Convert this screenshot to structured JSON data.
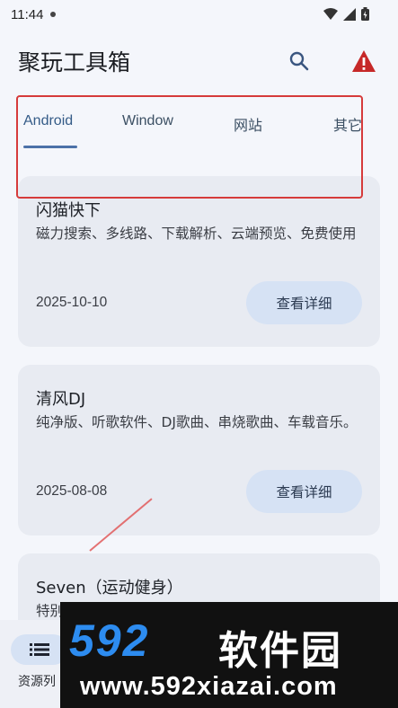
{
  "status_bar": {
    "time": "11:44"
  },
  "app_bar": {
    "title": "聚玩工具箱",
    "icons": [
      "search-icon",
      "warning-icon"
    ],
    "warning_color": "#c62828"
  },
  "tabs": [
    {
      "label": "Android",
      "active": true
    },
    {
      "label": "Window",
      "active": false
    },
    {
      "label": "网站",
      "active": false
    },
    {
      "label": "其它",
      "active": false
    }
  ],
  "cards": [
    {
      "title": "闪猫快下",
      "desc": "磁力搜索、多线路、下载解析、云端预览、免费使用",
      "date": "2025-10-10",
      "button": "查看详细"
    },
    {
      "title": "清风DJ",
      "desc": "纯净版、听歌软件、DJ歌曲、串烧歌曲、车载音乐。",
      "date": "2025-08-08",
      "button": "查看详细"
    },
    {
      "title": "Seven（运动健身）",
      "desc": "特别"
    }
  ],
  "bottom_nav": {
    "label": "资源列"
  },
  "watermark": {
    "brand": "592",
    "brand_cn": "软件园",
    "url": "www.592xiazai.com"
  },
  "colors": {
    "accent": "#4c72a8",
    "button_bg": "#d6e2f4",
    "card_bg": "#e8ebf2",
    "highlight": "#d63b3b"
  }
}
